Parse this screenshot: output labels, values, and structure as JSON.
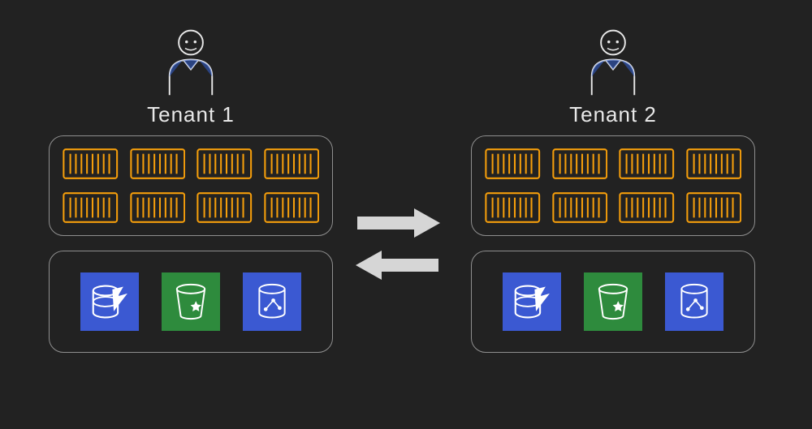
{
  "tenants": [
    {
      "label": "Tenant 1"
    },
    {
      "label": "Tenant 2"
    }
  ],
  "icons": {
    "user": "user-icon",
    "container": "container-icon",
    "dynamodb": "dynamodb-icon",
    "s3": "s3-bucket-icon",
    "neptune": "graph-db-icon",
    "arrow_right": "arrow-right-icon",
    "arrow_left": "arrow-left-icon"
  },
  "colors": {
    "background": "#222222",
    "border": "#8f8f8f",
    "container_orange": "#f59e0b",
    "svc_blue": "#3b59d2",
    "svc_green": "#2e8b3d",
    "arrow_gray": "#d6d6d6",
    "user_blue": "#325fcf",
    "text": "#e8e8e8"
  },
  "layout": {
    "containers_per_tenant": 8,
    "services_per_tenant": [
      "dynamodb",
      "s3",
      "neptune"
    ]
  }
}
